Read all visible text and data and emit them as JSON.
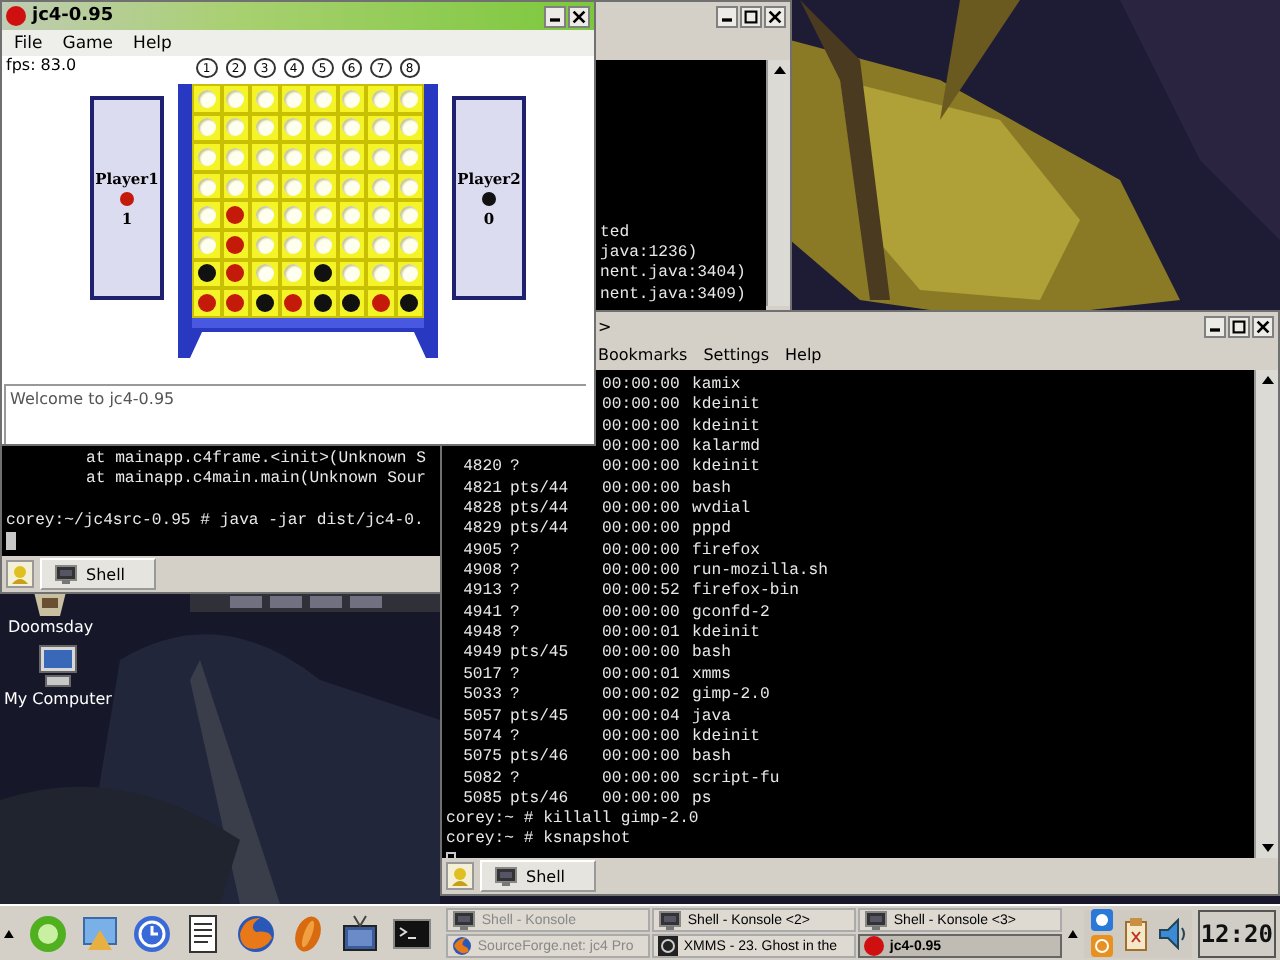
{
  "desktop_icons": [
    {
      "kind": "game",
      "label": "Doomsday"
    },
    {
      "kind": "computer",
      "label": "My Computer"
    }
  ],
  "back_terminal": {
    "right_fragments": [
      "ted",
      "java:1236)",
      "nent.java:3404)",
      "nent.java:3409)"
    ],
    "lines": [
      {
        "kind": "trace",
        "text": "at mainapp.c4frame.<init>(Unknown S"
      },
      {
        "kind": "trace",
        "text": "at mainapp.c4main.main(Unknown Sour"
      },
      {
        "kind": "blank"
      },
      {
        "kind": "prompt",
        "text": "corey:~/jc4src-0.95 # java -jar dist/jc4-0."
      },
      {
        "kind": "cursor"
      }
    ],
    "tabs": [
      {
        "label": "Shell",
        "selected": true
      }
    ]
  },
  "ps_terminal": {
    "title": ">",
    "menu": [
      "Bookmarks",
      "Settings",
      "Help"
    ],
    "processes": [
      {
        "time": "00:00:00",
        "command": "kamix"
      },
      {
        "time": "00:00:00",
        "command": "kdeinit"
      },
      {
        "time": "00:00:00",
        "command": "kdeinit"
      },
      {
        "time": "00:00:00",
        "command": "kalarmd"
      },
      {
        "pid": "4820",
        "tty": "?",
        "time": "00:00:00",
        "command": "kdeinit"
      },
      {
        "pid": "4821",
        "tty": "pts/44",
        "time": "00:00:00",
        "command": "bash"
      },
      {
        "pid": "4828",
        "tty": "pts/44",
        "time": "00:00:00",
        "command": "wvdial"
      },
      {
        "pid": "4829",
        "tty": "pts/44",
        "time": "00:00:00",
        "command": "pppd"
      },
      {
        "pid": "4905",
        "tty": "?",
        "time": "00:00:00",
        "command": "firefox"
      },
      {
        "pid": "4908",
        "tty": "?",
        "time": "00:00:00",
        "command": "run-mozilla.sh"
      },
      {
        "pid": "4913",
        "tty": "?",
        "time": "00:00:52",
        "command": "firefox-bin"
      },
      {
        "pid": "4941",
        "tty": "?",
        "time": "00:00:00",
        "command": "gconfd-2"
      },
      {
        "pid": "4948",
        "tty": "?",
        "time": "00:00:01",
        "command": "kdeinit"
      },
      {
        "pid": "4949",
        "tty": "pts/45",
        "time": "00:00:00",
        "command": "bash"
      },
      {
        "pid": "5017",
        "tty": "?",
        "time": "00:00:01",
        "command": "xmms"
      },
      {
        "pid": "5033",
        "tty": "?",
        "time": "00:00:02",
        "command": "gimp-2.0"
      },
      {
        "pid": "5057",
        "tty": "pts/45",
        "time": "00:00:04",
        "command": "java"
      },
      {
        "pid": "5074",
        "tty": "?",
        "time": "00:00:00",
        "command": "kdeinit"
      },
      {
        "pid": "5075",
        "tty": "pts/46",
        "time": "00:00:00",
        "command": "bash"
      },
      {
        "pid": "5082",
        "tty": "?",
        "time": "00:00:00",
        "command": "script-fu"
      },
      {
        "pid": "5085",
        "tty": "pts/46",
        "time": "00:00:00",
        "command": "ps"
      }
    ],
    "prompt_lines": [
      "corey:~ # killall gimp-2.0",
      "corey:~ # ksnapshot"
    ],
    "tabs": [
      {
        "label": "Shell",
        "selected": true
      }
    ]
  },
  "game_window": {
    "title": "jc4-0.95",
    "menu": [
      "File",
      "Game",
      "Help"
    ],
    "fps": "fps: 83.0",
    "column_numbers": [
      "1",
      "2",
      "3",
      "4",
      "5",
      "6",
      "7",
      "8"
    ],
    "board": [
      {
        "cells": [
          {
            "kind": "empty"
          },
          {
            "kind": "empty"
          },
          {
            "kind": "empty"
          },
          {
            "kind": "empty"
          },
          {
            "kind": "empty"
          },
          {
            "kind": "empty"
          },
          {
            "kind": "empty"
          },
          {
            "kind": "empty"
          }
        ]
      },
      {
        "cells": [
          {
            "kind": "empty"
          },
          {
            "kind": "empty"
          },
          {
            "kind": "empty"
          },
          {
            "kind": "empty"
          },
          {
            "kind": "empty"
          },
          {
            "kind": "empty"
          },
          {
            "kind": "empty"
          },
          {
            "kind": "empty"
          }
        ]
      },
      {
        "cells": [
          {
            "kind": "empty"
          },
          {
            "kind": "empty"
          },
          {
            "kind": "empty"
          },
          {
            "kind": "empty"
          },
          {
            "kind": "empty"
          },
          {
            "kind": "empty"
          },
          {
            "kind": "empty"
          },
          {
            "kind": "empty"
          }
        ]
      },
      {
        "cells": [
          {
            "kind": "empty"
          },
          {
            "kind": "empty"
          },
          {
            "kind": "empty"
          },
          {
            "kind": "empty"
          },
          {
            "kind": "empty"
          },
          {
            "kind": "empty"
          },
          {
            "kind": "empty"
          },
          {
            "kind": "empty"
          }
        ]
      },
      {
        "cells": [
          {
            "kind": "empty"
          },
          {
            "kind": "red"
          },
          {
            "kind": "empty"
          },
          {
            "kind": "empty"
          },
          {
            "kind": "empty"
          },
          {
            "kind": "empty"
          },
          {
            "kind": "empty"
          },
          {
            "kind": "empty"
          }
        ]
      },
      {
        "cells": [
          {
            "kind": "empty"
          },
          {
            "kind": "red"
          },
          {
            "kind": "empty"
          },
          {
            "kind": "empty"
          },
          {
            "kind": "empty"
          },
          {
            "kind": "empty"
          },
          {
            "kind": "empty"
          },
          {
            "kind": "empty"
          }
        ]
      },
      {
        "cells": [
          {
            "kind": "black"
          },
          {
            "kind": "red"
          },
          {
            "kind": "empty"
          },
          {
            "kind": "empty"
          },
          {
            "kind": "black"
          },
          {
            "kind": "empty"
          },
          {
            "kind": "empty"
          },
          {
            "kind": "empty"
          }
        ]
      },
      {
        "cells": [
          {
            "kind": "red"
          },
          {
            "kind": "red"
          },
          {
            "kind": "black"
          },
          {
            "kind": "red"
          },
          {
            "kind": "black"
          },
          {
            "kind": "black"
          },
          {
            "kind": "red"
          },
          {
            "kind": "black"
          }
        ]
      }
    ],
    "players": [
      {
        "name": "Player1",
        "color": "#c41a0a",
        "score": "1"
      },
      {
        "name": "Player2",
        "color": "#111111",
        "score": "0"
      }
    ],
    "message": "Welcome to jc4-0.95"
  },
  "taskbar": {
    "tasks": [
      {
        "label": "Shell - Konsole",
        "kind": "konsole",
        "selected": false,
        "minimized": true
      },
      {
        "label": "Shell - Konsole <2>",
        "kind": "konsole",
        "selected": false,
        "minimized": false
      },
      {
        "label": "Shell - Konsole <3>",
        "kind": "konsole",
        "selected": false,
        "minimized": false
      },
      {
        "label": "SourceForge.net: jc4 Pro",
        "kind": "browser",
        "selected": false,
        "minimized": true
      },
      {
        "label": "XMMS - 23. Ghost in the",
        "kind": "player",
        "selected": false,
        "minimized": false
      },
      {
        "label": "jc4-0.95",
        "kind": "app",
        "selected": true,
        "minimized": false
      }
    ],
    "clock": "12:20"
  }
}
